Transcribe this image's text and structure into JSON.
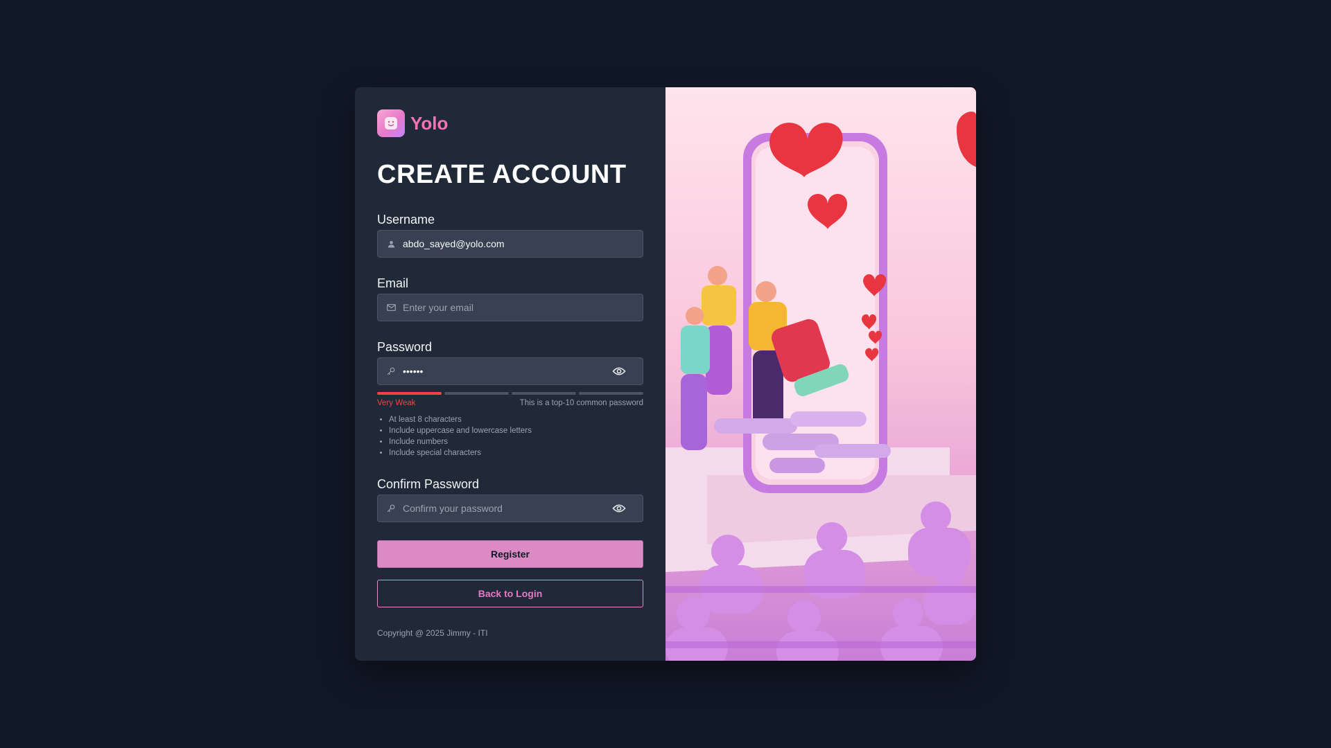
{
  "brand": {
    "name": "Yolo"
  },
  "page": {
    "title": "CREATE ACCOUNT"
  },
  "form": {
    "username": {
      "label": "Username",
      "value": "abdo_sayed@yolo.com",
      "icon": "user-icon"
    },
    "email": {
      "label": "Email",
      "placeholder": "Enter your email",
      "value": "",
      "icon": "mail-icon"
    },
    "password": {
      "label": "Password",
      "value": "••••••",
      "icon": "key-icon",
      "toggle_icon": "eye-icon",
      "strength": {
        "level": 1,
        "segments": 4,
        "label": "Very Weak",
        "note": "This is a top-10 common password",
        "color": "#ef4444"
      },
      "requirements": [
        "At least 8 characters",
        "Include uppercase and lowercase letters",
        "Include numbers",
        "Include special characters"
      ]
    },
    "confirm_password": {
      "label": "Confirm Password",
      "placeholder": "Confirm your password",
      "value": "",
      "icon": "key-icon",
      "toggle_icon": "eye-icon"
    },
    "register_label": "Register",
    "back_label": "Back to Login"
  },
  "footer": {
    "copyright": "Copyright @ 2025 Jimmy - ITI"
  },
  "colors": {
    "accent": "#e879c9",
    "brand": "#f472b6",
    "danger": "#ef4444",
    "background": "#111827",
    "panel": "#1f2937"
  },
  "illustration": {
    "icon": "social-media-illustration"
  }
}
